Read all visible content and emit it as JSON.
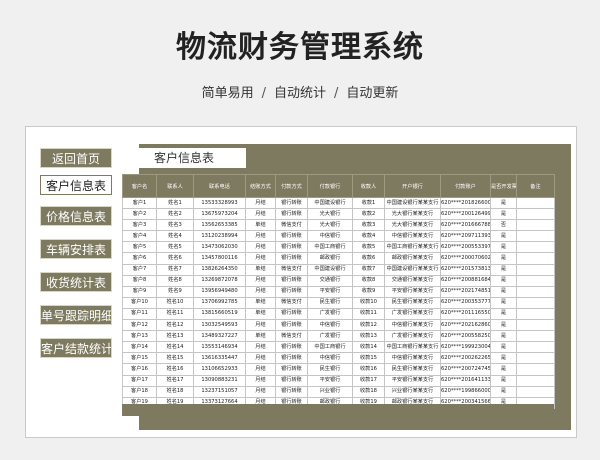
{
  "header": {
    "title": "物流财务管理系统",
    "tagline": [
      "简单易用",
      "自动统计",
      "自动更新"
    ],
    "separator": "/"
  },
  "sidebar": {
    "items": [
      {
        "label": "返回首页",
        "active": false
      },
      {
        "label": "客户信息表",
        "active": true
      },
      {
        "label": "价格信息表",
        "active": false
      },
      {
        "label": "车辆安排表",
        "active": false
      },
      {
        "label": "收货统计表",
        "active": false
      },
      {
        "label": "单号跟踪明细",
        "active": false
      },
      {
        "label": "客户结款统计",
        "active": false
      }
    ]
  },
  "sheet": {
    "title": "客户信息表",
    "columns": [
      "客户名",
      "联系人",
      "联系电话",
      "结账方式",
      "付款方式",
      "付款银行",
      "收款人",
      "开户银行",
      "付款账户",
      "是否开发票",
      "备注"
    ],
    "rows": [
      [
        "客户1",
        "姓名1",
        "13533328993",
        "月结",
        "银行转账",
        "中国建设银行",
        "收款1",
        "中国建设银行某某支行",
        "620****2018266004",
        "是",
        ""
      ],
      [
        "客户2",
        "姓名2",
        "13675973204",
        "月结",
        "银行转账",
        "光大银行",
        "收款2",
        "光大银行某某支行",
        "620****2001264995",
        "是",
        ""
      ],
      [
        "客户3",
        "姓名3",
        "13562653385",
        "单结",
        "微信支付",
        "光大银行",
        "收款3",
        "光大银行某某支行",
        "620****2016667889",
        "否",
        ""
      ],
      [
        "客户4",
        "姓名4",
        "13120238994",
        "月结",
        "银行转账",
        "中信银行",
        "收款4",
        "中信银行某某支行",
        "620****209711393",
        "是",
        ""
      ],
      [
        "客户5",
        "姓名5",
        "13473062030",
        "月结",
        "银行转账",
        "中国工商银行",
        "收款5",
        "中国工商银行某某支行",
        "620****2005533975",
        "是",
        ""
      ],
      [
        "客户6",
        "姓名6",
        "13457800116",
        "月结",
        "银行转账",
        "邮政银行",
        "收款6",
        "邮政银行某某支行",
        "620****2000706029",
        "是",
        ""
      ],
      [
        "客户7",
        "姓名7",
        "13826264350",
        "单结",
        "微信支付",
        "中国建设银行",
        "收款7",
        "中国建设银行某某支行",
        "620****2015738136",
        "是",
        ""
      ],
      [
        "客户8",
        "姓名8",
        "13269872078",
        "月结",
        "银行转账",
        "交通银行",
        "收款8",
        "交通银行某某支行",
        "620****2008816847",
        "是",
        ""
      ],
      [
        "客户9",
        "姓名9",
        "13956949480",
        "月结",
        "银行转账",
        "平安银行",
        "收款9",
        "平安银行某某支行",
        "620****2021748517",
        "是",
        ""
      ],
      [
        "客户10",
        "姓名10",
        "13706992785",
        "单结",
        "微信支付",
        "民生银行",
        "收款10",
        "民生银行某某支行",
        "620****2003537770",
        "是",
        ""
      ],
      [
        "客户11",
        "姓名11",
        "13815660519",
        "单结",
        "银行转账",
        "广发银行",
        "收款11",
        "广发银行某某支行",
        "620****2011165507",
        "是",
        ""
      ],
      [
        "客户12",
        "姓名12",
        "13032549593",
        "月结",
        "银行转账",
        "中信银行",
        "收款12",
        "中信银行某某支行",
        "620****2021628607",
        "是",
        ""
      ],
      [
        "客户13",
        "姓名13",
        "13489327227",
        "单结",
        "微信支付",
        "广发银行",
        "收款13",
        "广发银行某某支行",
        "620****2005582503",
        "是",
        ""
      ],
      [
        "客户14",
        "姓名14",
        "13553146934",
        "月结",
        "银行转账",
        "中国工商银行",
        "收款14",
        "中国工商银行某某支行",
        "620****1999230047",
        "是",
        ""
      ],
      [
        "客户15",
        "姓名15",
        "13616335447",
        "月结",
        "银行转账",
        "中信银行",
        "收款15",
        "中信银行某某支行",
        "620****2002622651",
        "是",
        ""
      ],
      [
        "客户16",
        "姓名16",
        "13106652933",
        "月结",
        "银行转账",
        "民生银行",
        "收款16",
        "民生银行某某支行",
        "620****200724745",
        "是",
        ""
      ],
      [
        "客户17",
        "姓名17",
        "13090883231",
        "月结",
        "银行转账",
        "平安银行",
        "收款17",
        "平安银行某某支行",
        "620****2016411331",
        "是",
        ""
      ],
      [
        "客户18",
        "姓名18",
        "13237151057",
        "月结",
        "银行转账",
        "兴业银行",
        "收款18",
        "兴业银行某某支行",
        "620****1998660005",
        "是",
        ""
      ],
      [
        "客户19",
        "姓名19",
        "13373127664",
        "月结",
        "银行转账",
        "邮政银行",
        "收款19",
        "邮政银行某某支行",
        "620****2003415661",
        "是",
        ""
      ]
    ]
  },
  "colors": {
    "accent": "#7d7a5f",
    "background": "#f0f0f0"
  }
}
